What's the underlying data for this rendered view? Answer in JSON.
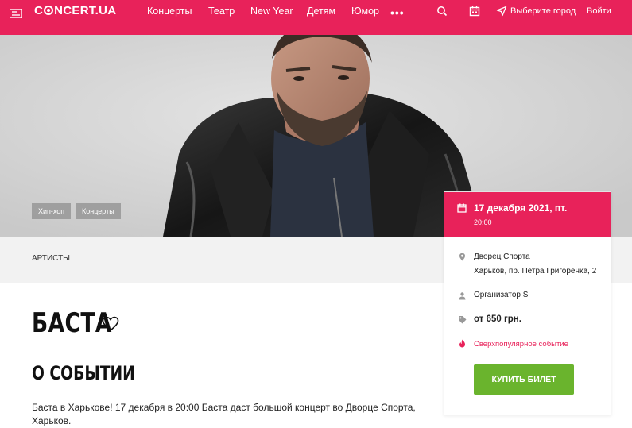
{
  "header": {
    "logo": {
      "pre": "C",
      "post": "NCERT.UA"
    },
    "nav": [
      "Концерты",
      "Театр",
      "New Year",
      "Детям",
      "Юмор"
    ],
    "more": "•••",
    "city": "Выберите город",
    "login": "Войти"
  },
  "hero": {
    "tags": [
      "Хип-хоп",
      "Концерты"
    ]
  },
  "breadcrumb": "АРТИСТЫ",
  "event": {
    "title": "БАСТА",
    "about_heading": "О СОБЫТИИ",
    "description": "Баста в Харькове! 17 декабря в 20:00 Баста даст большой концерт во Дворце Спорта, Харьков."
  },
  "card": {
    "date": "17 декабря 2021, пт.",
    "time": "20:00",
    "venue": "Дворец Спорта",
    "address": "Харьков, пр. Петра Григоренка, 2",
    "organizer": "Организатор S",
    "price": "от 650 грн.",
    "popular": "Сверхпопулярное событие",
    "buy": "КУПИТЬ БИЛЕТ"
  },
  "colors": {
    "brand": "#e8225a",
    "buy_button": "#6ab42d"
  },
  "icons": [
    "menu-icon",
    "search-icon",
    "calendar-icon",
    "send-location-icon",
    "heart-icon",
    "location-pin-icon",
    "person-icon",
    "price-tag-icon",
    "fire-icon"
  ]
}
